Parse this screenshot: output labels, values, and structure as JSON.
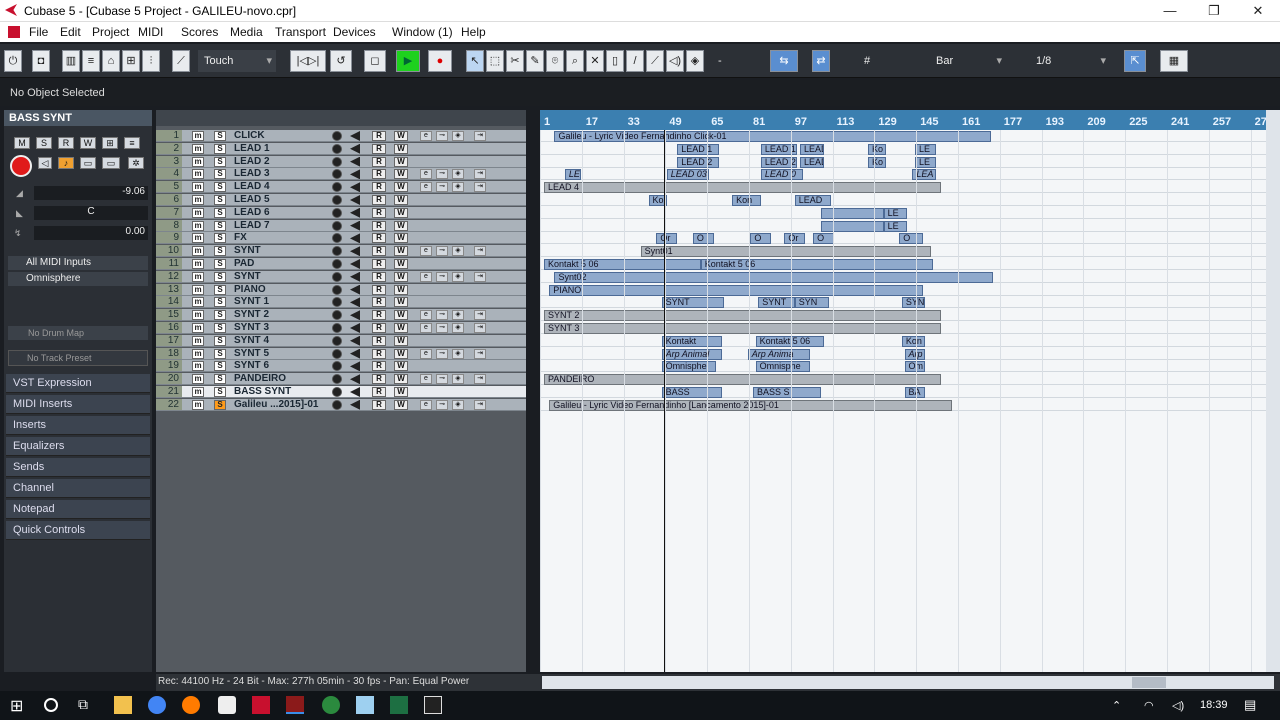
{
  "window": {
    "title": "Cubase 5 - [Cubase 5 Project - GALILEU-novo.cpr]",
    "minimize": "—",
    "restore": "❐",
    "close": "✕"
  },
  "menu": [
    "File",
    "Edit",
    "Project",
    "MIDI",
    "Scores",
    "Media",
    "Transport",
    "Devices",
    "Window (1)",
    "Help"
  ],
  "toolbar": {
    "automation_mode": "Touch",
    "grid_type": "Bar",
    "quantize": "1/8",
    "snap_dash": "-"
  },
  "status": {
    "selection": "No Object Selected"
  },
  "inspector": {
    "track_name": "BASS SYNT",
    "volume": "-9.06",
    "pan": "C",
    "delay": "0.00",
    "midi_input": "All MIDI Inputs",
    "output": "Omnisphere",
    "drum_map": "No Drum Map",
    "track_preset": "No Track Preset",
    "sections": [
      "VST Expression",
      "MIDI Inserts",
      "Inserts",
      "Equalizers",
      "Sends",
      "Channel",
      "Notepad",
      "Quick Controls"
    ]
  },
  "tracks": [
    {
      "n": "1",
      "name": "CLICK"
    },
    {
      "n": "2",
      "name": "LEAD 1"
    },
    {
      "n": "3",
      "name": "LEAD 2"
    },
    {
      "n": "4",
      "name": "LEAD 3"
    },
    {
      "n": "5",
      "name": "LEAD 4"
    },
    {
      "n": "6",
      "name": "LEAD 5"
    },
    {
      "n": "7",
      "name": "LEAD 6"
    },
    {
      "n": "8",
      "name": "LEAD 7"
    },
    {
      "n": "9",
      "name": "FX"
    },
    {
      "n": "10",
      "name": "SYNT"
    },
    {
      "n": "11",
      "name": "PAD"
    },
    {
      "n": "12",
      "name": "SYNT"
    },
    {
      "n": "13",
      "name": "PIANO"
    },
    {
      "n": "14",
      "name": "SYNT 1"
    },
    {
      "n": "15",
      "name": "SYNT 2"
    },
    {
      "n": "16",
      "name": "SYNT 3"
    },
    {
      "n": "17",
      "name": "SYNT 4"
    },
    {
      "n": "18",
      "name": "SYNT 5"
    },
    {
      "n": "19",
      "name": "SYNT 6"
    },
    {
      "n": "20",
      "name": "PANDEIRO"
    },
    {
      "n": "21",
      "name": "BASS SYNT"
    },
    {
      "n": "22",
      "name": "Galileu ...2015]-01"
    }
  ],
  "ruler": [
    "1",
    "17",
    "33",
    "49",
    "65",
    "81",
    "97",
    "113",
    "129",
    "145",
    "161",
    "177",
    "193",
    "209",
    "225",
    "241",
    "257",
    "27"
  ],
  "parts": [
    {
      "lane": 0,
      "label": "Galileu - Lyric Video Fernandinho Click-01",
      "bar_start": 5,
      "bar_end": 172,
      "style": "normal"
    },
    {
      "lane": 1,
      "label": "LEAD 1",
      "bar_start": 52,
      "bar_end": 68,
      "style": "normal"
    },
    {
      "lane": 1,
      "label": "LEAD 1",
      "bar_start": 84,
      "bar_end": 98,
      "style": "normal"
    },
    {
      "lane": 1,
      "label": "LEAD 1",
      "bar_start": 99,
      "bar_end": 108,
      "style": "normal"
    },
    {
      "lane": 1,
      "label": "Ko",
      "bar_start": 125,
      "bar_end": 132,
      "style": "normal"
    },
    {
      "lane": 1,
      "label": "LE",
      "bar_start": 143,
      "bar_end": 151,
      "style": "normal"
    },
    {
      "lane": 2,
      "label": "LEAD 2",
      "bar_start": 52,
      "bar_end": 68,
      "style": "normal"
    },
    {
      "lane": 2,
      "label": "LEAD 2",
      "bar_start": 84,
      "bar_end": 98,
      "style": "normal"
    },
    {
      "lane": 2,
      "label": "LEAD 2",
      "bar_start": 99,
      "bar_end": 108,
      "style": "normal"
    },
    {
      "lane": 2,
      "label": "Ko",
      "bar_start": 125,
      "bar_end": 132,
      "style": "normal"
    },
    {
      "lane": 2,
      "label": "LE",
      "bar_start": 143,
      "bar_end": 151,
      "style": "normal"
    },
    {
      "lane": 3,
      "label": "LE",
      "bar_start": 9,
      "bar_end": 15,
      "style": "italic"
    },
    {
      "lane": 3,
      "label": "LEAD 03",
      "bar_start": 48,
      "bar_end": 64,
      "style": "italic"
    },
    {
      "lane": 3,
      "label": "LEAD 0",
      "bar_start": 84,
      "bar_end": 100,
      "style": "italic"
    },
    {
      "lane": 3,
      "label": "LEA",
      "bar_start": 142,
      "bar_end": 151,
      "style": "italic"
    },
    {
      "lane": 4,
      "label": "LEAD 4",
      "bar_start": 1,
      "bar_end": 153,
      "style": "long"
    },
    {
      "lane": 5,
      "label": "Ko",
      "bar_start": 41,
      "bar_end": 48,
      "style": "normal"
    },
    {
      "lane": 5,
      "label": "Kon",
      "bar_start": 73,
      "bar_end": 84,
      "style": "normal"
    },
    {
      "lane": 5,
      "label": "LEAD",
      "bar_start": 97,
      "bar_end": 111,
      "style": "normal"
    },
    {
      "lane": 6,
      "label": "",
      "bar_start": 107,
      "bar_end": 131,
      "style": "normal"
    },
    {
      "lane": 6,
      "label": "LE",
      "bar_start": 131,
      "bar_end": 140,
      "style": "normal"
    },
    {
      "lane": 7,
      "label": "",
      "bar_start": 107,
      "bar_end": 131,
      "style": "normal"
    },
    {
      "lane": 7,
      "label": "LE",
      "bar_start": 131,
      "bar_end": 140,
      "style": "normal"
    },
    {
      "lane": 8,
      "label": "Or",
      "bar_start": 44,
      "bar_end": 52,
      "style": "normal"
    },
    {
      "lane": 8,
      "label": "O",
      "bar_start": 58,
      "bar_end": 66,
      "style": "normal"
    },
    {
      "lane": 8,
      "label": "O",
      "bar_start": 80,
      "bar_end": 88,
      "style": "normal"
    },
    {
      "lane": 8,
      "label": "Or",
      "bar_start": 93,
      "bar_end": 101,
      "style": "normal"
    },
    {
      "lane": 8,
      "label": "O",
      "bar_start": 104,
      "bar_end": 112,
      "style": "normal"
    },
    {
      "lane": 8,
      "label": "O",
      "bar_start": 137,
      "bar_end": 146,
      "style": "normal"
    },
    {
      "lane": 9,
      "label": "Synt01",
      "bar_start": 38,
      "bar_end": 149,
      "style": "long"
    },
    {
      "lane": 10,
      "label": "Kontakt 5 06",
      "bar_start": 1,
      "bar_end": 61,
      "style": "normal"
    },
    {
      "lane": 10,
      "label": "Kontakt 5 06",
      "bar_start": 61,
      "bar_end": 150,
      "style": "normal"
    },
    {
      "lane": 11,
      "label": "Synt02",
      "bar_start": 5,
      "bar_end": 173,
      "style": "normal"
    },
    {
      "lane": 12,
      "label": "PIANO",
      "bar_start": 3,
      "bar_end": 146,
      "style": "normal"
    },
    {
      "lane": 13,
      "label": "SYNT",
      "bar_start": 46,
      "bar_end": 70,
      "style": "normal"
    },
    {
      "lane": 13,
      "label": "SYNT",
      "bar_start": 83,
      "bar_end": 97,
      "style": "normal"
    },
    {
      "lane": 13,
      "label": "SYN",
      "bar_start": 97,
      "bar_end": 110,
      "style": "normal"
    },
    {
      "lane": 13,
      "label": "SYN",
      "bar_start": 138,
      "bar_end": 147,
      "style": "normal"
    },
    {
      "lane": 14,
      "label": "SYNT 2",
      "bar_start": 1,
      "bar_end": 153,
      "style": "long"
    },
    {
      "lane": 15,
      "label": "SYNT 3",
      "bar_start": 1,
      "bar_end": 153,
      "style": "long"
    },
    {
      "lane": 16,
      "label": "Kontakt",
      "bar_start": 46,
      "bar_end": 69,
      "style": "normal"
    },
    {
      "lane": 16,
      "label": "Kontakt 5 06",
      "bar_start": 82,
      "bar_end": 108,
      "style": "normal"
    },
    {
      "lane": 16,
      "label": "Kon",
      "bar_start": 138,
      "bar_end": 147,
      "style": "normal"
    },
    {
      "lane": 17,
      "label": "Arp Animal",
      "bar_start": 46,
      "bar_end": 69,
      "style": "italic"
    },
    {
      "lane": 17,
      "label": "Arp Anima",
      "bar_start": 79,
      "bar_end": 103,
      "style": "italic"
    },
    {
      "lane": 17,
      "label": "Arp",
      "bar_start": 139,
      "bar_end": 147,
      "style": "italic"
    },
    {
      "lane": 18,
      "label": "Omnisphe",
      "bar_start": 46,
      "bar_end": 67,
      "style": "normal"
    },
    {
      "lane": 18,
      "label": "Omnisphe",
      "bar_start": 82,
      "bar_end": 103,
      "style": "normal"
    },
    {
      "lane": 18,
      "label": "Om",
      "bar_start": 139,
      "bar_end": 147,
      "style": "normal"
    },
    {
      "lane": 19,
      "label": "PANDEIRO",
      "bar_start": 1,
      "bar_end": 153,
      "style": "long"
    },
    {
      "lane": 20,
      "label": "BASS",
      "bar_start": 46,
      "bar_end": 69,
      "style": "normal"
    },
    {
      "lane": 20,
      "label": "BASS S",
      "bar_start": 81,
      "bar_end": 107,
      "style": "normal"
    },
    {
      "lane": 20,
      "label": "BA",
      "bar_start": 139,
      "bar_end": 147,
      "style": "normal"
    },
    {
      "lane": 21,
      "label": "Galileu - Lyric Video Fernandinho [Lancamento 2015]-01",
      "bar_start": 3,
      "bar_end": 157,
      "style": "long"
    }
  ],
  "cursor_bar": 44,
  "footer": {
    "info": "Rec: 44100 Hz - 24 Bit - Max: 277h 05min - 30 fps - Pan: Equal Power"
  },
  "taskbar": {
    "time": "18:39"
  }
}
